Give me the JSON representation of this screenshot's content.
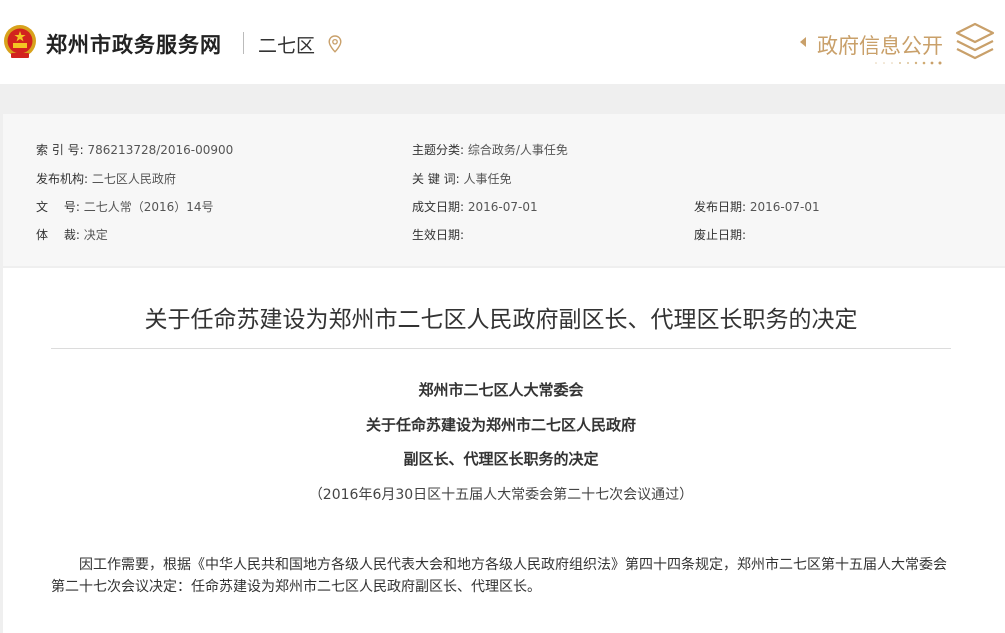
{
  "header": {
    "site_name": "郑州市政务服务网",
    "district": "二七区",
    "gov_info": "政府信息公开",
    "colors": {
      "accent": "#c9a06a"
    }
  },
  "meta": {
    "index": {
      "label": "索 引 号:",
      "value": "786213728/2016-00900"
    },
    "theme": {
      "label": "主题分类:",
      "value": "综合政务/人事任免"
    },
    "publisher": {
      "label": "发布机构:",
      "value": "二七区人民政府"
    },
    "keywords": {
      "label": "关 键 词:",
      "value": "人事任免"
    },
    "doc_no": {
      "label": "文　 号:",
      "value": "二七人常（2016）14号"
    },
    "created": {
      "label": "成文日期:",
      "value": "2016-07-01"
    },
    "published": {
      "label": "发布日期:",
      "value": "2016-07-01"
    },
    "genre": {
      "label": "体　 裁:",
      "value": "决定"
    },
    "effective": {
      "label": "生效日期:",
      "value": ""
    },
    "expiry": {
      "label": "废止日期:",
      "value": ""
    }
  },
  "article": {
    "title": "关于任命苏建设为郑州市二七区人民政府副区长、代理区长职务的决定",
    "issuer": "郑州市二七区人大常委会",
    "heading_line1": "关于任命苏建设为郑州市二七区人民政府",
    "heading_line2": "副区长、代理区长职务的决定",
    "note": "（2016年6月30日区十五届人大常委会第二十七次会议通过）",
    "body": "因工作需要，根据《中华人民共和国地方各级人民代表大会和地方各级人民政府组织法》第四十四条规定，郑州市二七区第十五届人大常委会第二十七次会议决定：任命苏建设为郑州市二七区人民政府副区长、代理区长。"
  }
}
